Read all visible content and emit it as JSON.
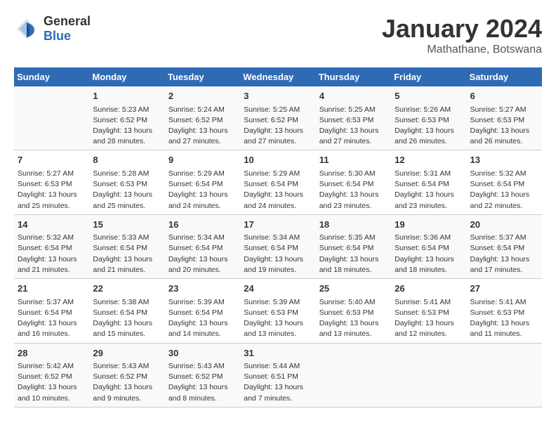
{
  "header": {
    "logo_general": "General",
    "logo_blue": "Blue",
    "month_year": "January 2024",
    "location": "Mathathane, Botswana"
  },
  "weekdays": [
    "Sunday",
    "Monday",
    "Tuesday",
    "Wednesday",
    "Thursday",
    "Friday",
    "Saturday"
  ],
  "weeks": [
    [
      {
        "day": "",
        "info": ""
      },
      {
        "day": "1",
        "info": "Sunrise: 5:23 AM\nSunset: 6:52 PM\nDaylight: 13 hours\nand 28 minutes."
      },
      {
        "day": "2",
        "info": "Sunrise: 5:24 AM\nSunset: 6:52 PM\nDaylight: 13 hours\nand 27 minutes."
      },
      {
        "day": "3",
        "info": "Sunrise: 5:25 AM\nSunset: 6:52 PM\nDaylight: 13 hours\nand 27 minutes."
      },
      {
        "day": "4",
        "info": "Sunrise: 5:25 AM\nSunset: 6:53 PM\nDaylight: 13 hours\nand 27 minutes."
      },
      {
        "day": "5",
        "info": "Sunrise: 5:26 AM\nSunset: 6:53 PM\nDaylight: 13 hours\nand 26 minutes."
      },
      {
        "day": "6",
        "info": "Sunrise: 5:27 AM\nSunset: 6:53 PM\nDaylight: 13 hours\nand 26 minutes."
      }
    ],
    [
      {
        "day": "7",
        "info": "Sunrise: 5:27 AM\nSunset: 6:53 PM\nDaylight: 13 hours\nand 25 minutes."
      },
      {
        "day": "8",
        "info": "Sunrise: 5:28 AM\nSunset: 6:53 PM\nDaylight: 13 hours\nand 25 minutes."
      },
      {
        "day": "9",
        "info": "Sunrise: 5:29 AM\nSunset: 6:54 PM\nDaylight: 13 hours\nand 24 minutes."
      },
      {
        "day": "10",
        "info": "Sunrise: 5:29 AM\nSunset: 6:54 PM\nDaylight: 13 hours\nand 24 minutes."
      },
      {
        "day": "11",
        "info": "Sunrise: 5:30 AM\nSunset: 6:54 PM\nDaylight: 13 hours\nand 23 minutes."
      },
      {
        "day": "12",
        "info": "Sunrise: 5:31 AM\nSunset: 6:54 PM\nDaylight: 13 hours\nand 23 minutes."
      },
      {
        "day": "13",
        "info": "Sunrise: 5:32 AM\nSunset: 6:54 PM\nDaylight: 13 hours\nand 22 minutes."
      }
    ],
    [
      {
        "day": "14",
        "info": "Sunrise: 5:32 AM\nSunset: 6:54 PM\nDaylight: 13 hours\nand 21 minutes."
      },
      {
        "day": "15",
        "info": "Sunrise: 5:33 AM\nSunset: 6:54 PM\nDaylight: 13 hours\nand 21 minutes."
      },
      {
        "day": "16",
        "info": "Sunrise: 5:34 AM\nSunset: 6:54 PM\nDaylight: 13 hours\nand 20 minutes."
      },
      {
        "day": "17",
        "info": "Sunrise: 5:34 AM\nSunset: 6:54 PM\nDaylight: 13 hours\nand 19 minutes."
      },
      {
        "day": "18",
        "info": "Sunrise: 5:35 AM\nSunset: 6:54 PM\nDaylight: 13 hours\nand 18 minutes."
      },
      {
        "day": "19",
        "info": "Sunrise: 5:36 AM\nSunset: 6:54 PM\nDaylight: 13 hours\nand 18 minutes."
      },
      {
        "day": "20",
        "info": "Sunrise: 5:37 AM\nSunset: 6:54 PM\nDaylight: 13 hours\nand 17 minutes."
      }
    ],
    [
      {
        "day": "21",
        "info": "Sunrise: 5:37 AM\nSunset: 6:54 PM\nDaylight: 13 hours\nand 16 minutes."
      },
      {
        "day": "22",
        "info": "Sunrise: 5:38 AM\nSunset: 6:54 PM\nDaylight: 13 hours\nand 15 minutes."
      },
      {
        "day": "23",
        "info": "Sunrise: 5:39 AM\nSunset: 6:54 PM\nDaylight: 13 hours\nand 14 minutes."
      },
      {
        "day": "24",
        "info": "Sunrise: 5:39 AM\nSunset: 6:53 PM\nDaylight: 13 hours\nand 13 minutes."
      },
      {
        "day": "25",
        "info": "Sunrise: 5:40 AM\nSunset: 6:53 PM\nDaylight: 13 hours\nand 13 minutes."
      },
      {
        "day": "26",
        "info": "Sunrise: 5:41 AM\nSunset: 6:53 PM\nDaylight: 13 hours\nand 12 minutes."
      },
      {
        "day": "27",
        "info": "Sunrise: 5:41 AM\nSunset: 6:53 PM\nDaylight: 13 hours\nand 11 minutes."
      }
    ],
    [
      {
        "day": "28",
        "info": "Sunrise: 5:42 AM\nSunset: 6:52 PM\nDaylight: 13 hours\nand 10 minutes."
      },
      {
        "day": "29",
        "info": "Sunrise: 5:43 AM\nSunset: 6:52 PM\nDaylight: 13 hours\nand 9 minutes."
      },
      {
        "day": "30",
        "info": "Sunrise: 5:43 AM\nSunset: 6:52 PM\nDaylight: 13 hours\nand 8 minutes."
      },
      {
        "day": "31",
        "info": "Sunrise: 5:44 AM\nSunset: 6:51 PM\nDaylight: 13 hours\nand 7 minutes."
      },
      {
        "day": "",
        "info": ""
      },
      {
        "day": "",
        "info": ""
      },
      {
        "day": "",
        "info": ""
      }
    ]
  ]
}
